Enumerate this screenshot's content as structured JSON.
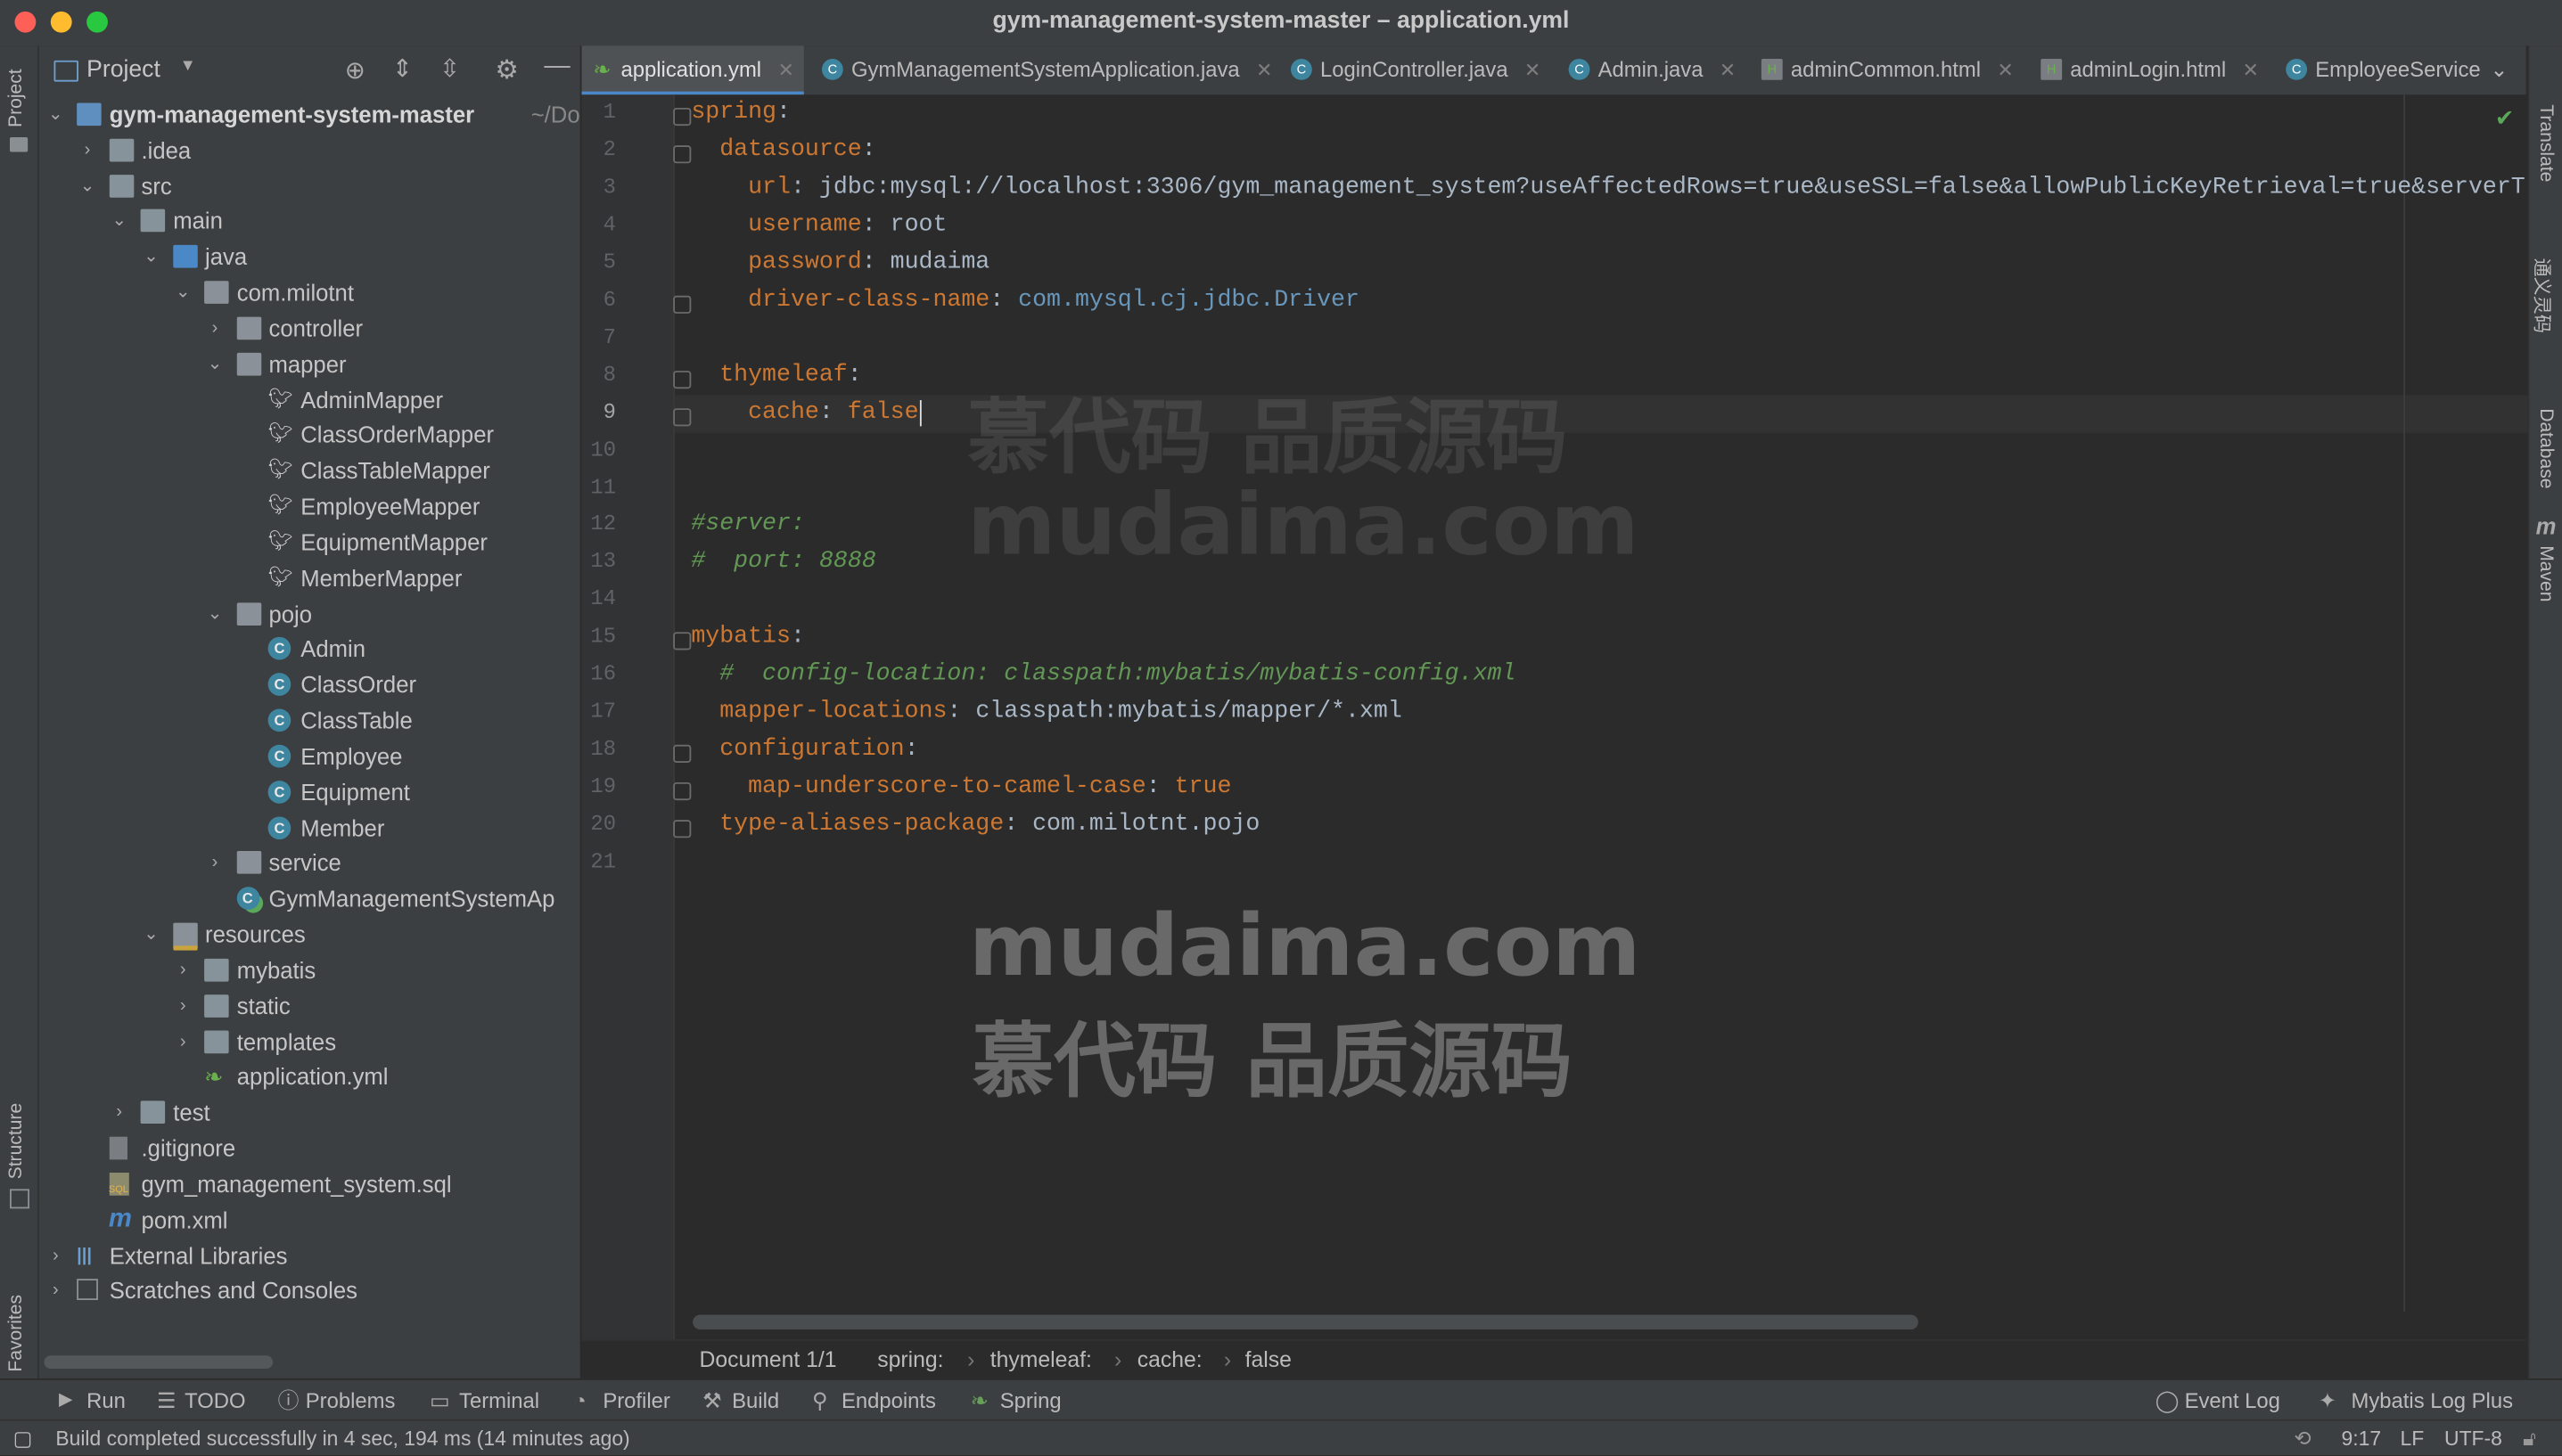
{
  "window": {
    "title": "gym-management-system-master – application.yml"
  },
  "left_strip": {
    "project_label": "Project",
    "structure_label": "Structure",
    "favorites_label": "Favorites"
  },
  "right_strip": {
    "translate_label": "Translate",
    "translate_zh_label": "通义灵码",
    "database_label": "Database",
    "maven_label": "Maven"
  },
  "project_panel": {
    "title": "Project",
    "tree": [
      {
        "label": "gym-management-system-master",
        "suffix": "~/Do",
        "bold": true
      },
      {
        "label": ".idea"
      },
      {
        "label": "src"
      },
      {
        "label": "main"
      },
      {
        "label": "java"
      },
      {
        "label": "com.milotnt"
      },
      {
        "label": "controller"
      },
      {
        "label": "mapper"
      },
      {
        "label": "AdminMapper"
      },
      {
        "label": "ClassOrderMapper"
      },
      {
        "label": "ClassTableMapper"
      },
      {
        "label": "EmployeeMapper"
      },
      {
        "label": "EquipmentMapper"
      },
      {
        "label": "MemberMapper"
      },
      {
        "label": "pojo"
      },
      {
        "label": "Admin"
      },
      {
        "label": "ClassOrder"
      },
      {
        "label": "ClassTable"
      },
      {
        "label": "Employee"
      },
      {
        "label": "Equipment"
      },
      {
        "label": "Member"
      },
      {
        "label": "service"
      },
      {
        "label": "GymManagementSystemAp"
      },
      {
        "label": "resources"
      },
      {
        "label": "mybatis"
      },
      {
        "label": "static"
      },
      {
        "label": "templates"
      },
      {
        "label": "application.yml"
      },
      {
        "label": "test"
      },
      {
        "label": ".gitignore"
      },
      {
        "label": "gym_management_system.sql"
      },
      {
        "label": "pom.xml"
      },
      {
        "label": "External Libraries"
      },
      {
        "label": "Scratches and Consoles"
      }
    ]
  },
  "tabs": [
    {
      "label": "application.yml",
      "active": true
    },
    {
      "label": "GymManagementSystemApplication.java"
    },
    {
      "label": "LoginController.java"
    },
    {
      "label": "Admin.java"
    },
    {
      "label": "adminCommon.html"
    },
    {
      "label": "adminLogin.html"
    },
    {
      "label": "EmployeeService"
    }
  ],
  "editor": {
    "line_numbers": [
      "1",
      "2",
      "3",
      "4",
      "5",
      "6",
      "7",
      "8",
      "9",
      "10",
      "11",
      "12",
      "13",
      "14",
      "15",
      "16",
      "17",
      "18",
      "19",
      "20",
      "21"
    ],
    "lines": [
      {
        "key": "spring",
        "sep": ":",
        "val": ""
      },
      {
        "key": "  datasource",
        "sep": ":",
        "val": ""
      },
      {
        "key": "    url",
        "sep": ": ",
        "val": "jdbc:mysql://localhost:3306/gym_management_system?useAffectedRows=true&useSSL=false&allowPublicKeyRetrieval=true&serverT"
      },
      {
        "key": "    username",
        "sep": ": ",
        "val": "root"
      },
      {
        "key": "    password",
        "sep": ": ",
        "val": "mudaima"
      },
      {
        "key": "    driver-class-name",
        "sep": ": ",
        "val": "com.mysql.cj.jdbc.Driver"
      },
      {
        "key": "",
        "sep": "",
        "val": ""
      },
      {
        "key": "  thymeleaf",
        "sep": ":",
        "val": ""
      },
      {
        "key": "    cache",
        "sep": ": ",
        "val": "false"
      },
      {
        "key": "",
        "sep": "",
        "val": ""
      },
      {
        "key": "",
        "sep": "",
        "val": ""
      },
      {
        "comment": "#server:"
      },
      {
        "comment": "#  port: 8888"
      },
      {
        "key": "",
        "sep": "",
        "val": ""
      },
      {
        "key": "mybatis",
        "sep": ":",
        "val": ""
      },
      {
        "comment": "  #  config-location: classpath:mybatis/mybatis-config.xml"
      },
      {
        "key": "  mapper-locations",
        "sep": ": ",
        "val": "classpath:mybatis/mapper/*.xml"
      },
      {
        "key": "  configuration",
        "sep": ":",
        "val": ""
      },
      {
        "key": "    map-underscore-to-camel-case",
        "sep": ": ",
        "val": "true"
      },
      {
        "key": "  type-aliases-package",
        "sep": ": ",
        "val": "com.milotnt.pojo"
      },
      {
        "key": "",
        "sep": "",
        "val": ""
      }
    ]
  },
  "watermarks": {
    "cn": "慕代码 品质源码",
    "en": "mudaima.com"
  },
  "breadcrumb": {
    "document": "Document 1/1",
    "items": [
      "spring:",
      "thymeleaf:",
      "cache:",
      "false"
    ]
  },
  "tool_windows": {
    "left": [
      "Run",
      "TODO",
      "Problems",
      "Terminal",
      "Profiler",
      "Build",
      "Endpoints",
      "Spring"
    ],
    "right": [
      "Event Log",
      "Mybatis Log Plus"
    ]
  },
  "status": {
    "message": "Build completed successfully in 4 sec, 194 ms (14 minutes ago)",
    "position": "9:17",
    "line_sep": "LF",
    "encoding": "UTF-8"
  },
  "colors": {
    "accent": "#4a88c7",
    "keyword": "#cc7832",
    "comment": "#629755",
    "number": "#6897bb"
  }
}
